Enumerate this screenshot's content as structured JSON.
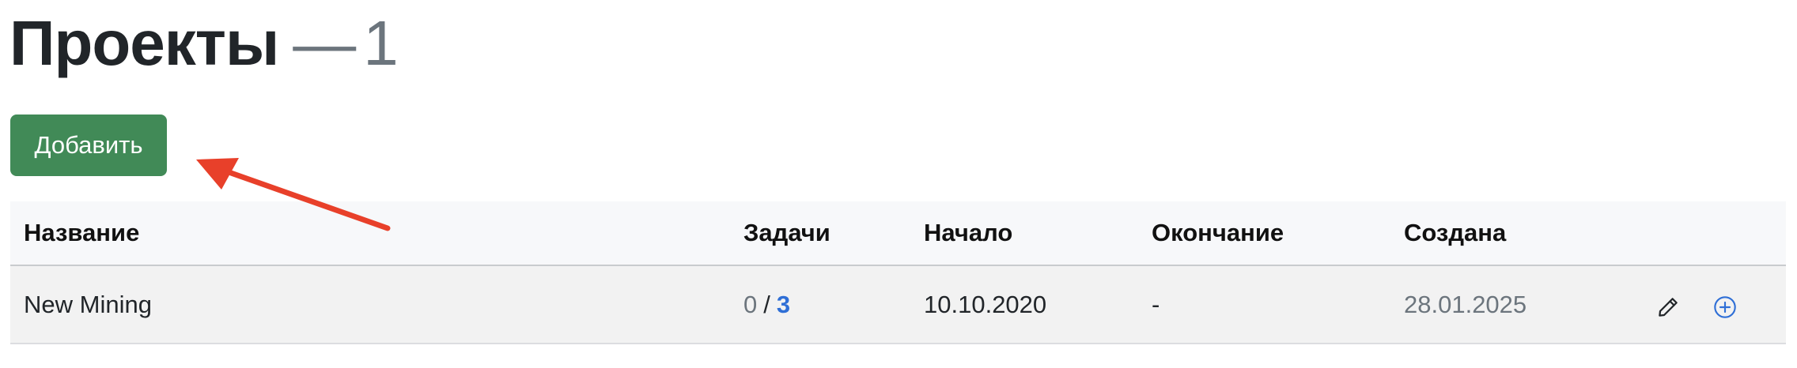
{
  "header": {
    "title": "Проекты",
    "dash": "—",
    "count": "1"
  },
  "toolbar": {
    "add_label": "Добавить"
  },
  "table": {
    "columns": [
      "Название",
      "Задачи",
      "Начало",
      "Окончание",
      "Создана"
    ],
    "rows": [
      {
        "name": "New Mining",
        "tasks_done": "0",
        "tasks_separator": "/",
        "tasks_total": "3",
        "start": "10.10.2020",
        "end": "-",
        "created": "28.01.2025",
        "actions": [
          "pencil-icon",
          "plus-circle-icon"
        ]
      }
    ]
  },
  "colors": {
    "add_button": "#418a57",
    "link": "#2f6fd6",
    "muted": "#6c757d",
    "annotation_arrow": "#e8402a"
  }
}
